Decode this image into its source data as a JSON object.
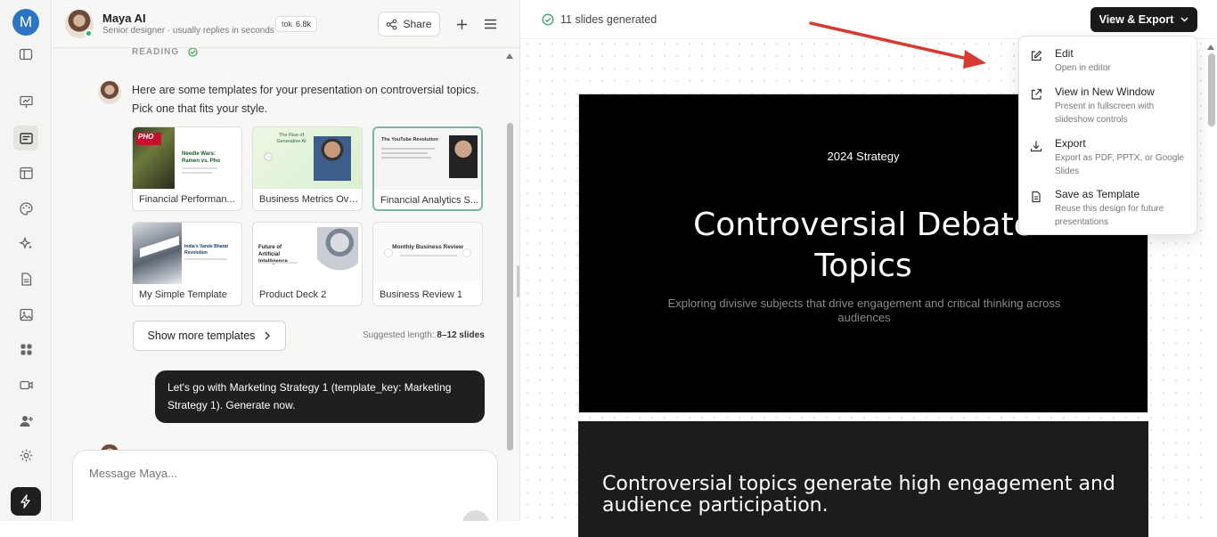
{
  "rail": {
    "avatar_letter": "M"
  },
  "chat": {
    "assistant_name": "Maya AI",
    "assistant_subtitle": "Senior designer · usually replies in seconds",
    "tokens_label": "tok",
    "tokens_value": "6.8k",
    "share_label": "Share",
    "reading_label": "READING",
    "assistant_message": "Here are some templates for your presentation on controversial topics. Pick one that fits your style.",
    "templates": [
      {
        "label": "Financial Performan..."
      },
      {
        "label": "Business Metrics Ove..."
      },
      {
        "label": "Financial Analytics S..."
      },
      {
        "label": "My Simple Template"
      },
      {
        "label": "Product Deck 2"
      },
      {
        "label": "Business Review 1"
      }
    ],
    "thumb_text": {
      "t1_title": "Needle Wars: Ramen vs. Pho",
      "t1_tag": "PHO",
      "t2_title": "The Rise of Generative AI",
      "t3_title": "The YouTube Revolution",
      "t4_title": "India's Vande Bharat Revolution",
      "t5_title": "Future of Artificial Intelligence",
      "t6_title": "Monthly Business Review"
    },
    "show_more_label": "Show more templates",
    "suggested_prefix": "Suggested length:",
    "suggested_value": "8–12 slides",
    "user_message": "Let's go with Marketing Strategy 1 (template_key: Marketing Strategy 1). Generate now.",
    "composer_placeholder": "Message Maya..."
  },
  "main": {
    "status": "11 slides generated",
    "view_export_label": "View & Export",
    "menu": [
      {
        "title": "Edit",
        "desc": "Open in editor",
        "icon": "edit-icon"
      },
      {
        "title": "View in New Window",
        "desc": "Present in fullscreen with slideshow controls",
        "icon": "external-link-icon"
      },
      {
        "title": "Export",
        "desc": "Export as PDF, PPTX, or Google Slides",
        "icon": "download-icon"
      },
      {
        "title": "Save as Template",
        "desc": "Reuse this design for future presentations",
        "icon": "document-icon"
      }
    ],
    "slide1": {
      "kicker": "2024 Strategy",
      "title_line1": "Controversial Debate",
      "title_line2": "Topics",
      "subtitle": "Exploring divisive subjects that drive engagement and critical thinking across audiences"
    },
    "slide2": {
      "text": "Controversial topics generate high engagement and audience participation."
    }
  },
  "colors": {
    "accent_dark": "#1a1a1a",
    "online": "#2fb463",
    "annotation_arrow": "#d63a32",
    "check_green": "#3aa35c"
  }
}
